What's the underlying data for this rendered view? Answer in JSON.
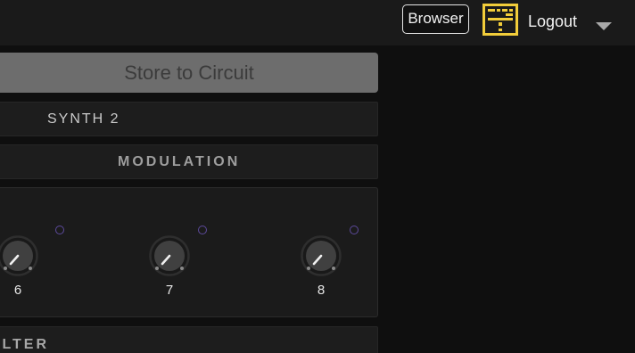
{
  "header": {
    "browser_label": "Browser",
    "logout_label": "Logout"
  },
  "patch": {
    "store_label": "Store to Circuit",
    "synth_name": "SYNTH 2"
  },
  "sections": {
    "modulation_title": "MODULATION",
    "filter_title": "ILTER"
  },
  "knobs": [
    {
      "label": "6"
    },
    {
      "label": "7"
    },
    {
      "label": "8"
    }
  ],
  "colors": {
    "accent_logo": "#f2cd3a",
    "mod_ring": "#5d4a9c",
    "store_button": "#6d6d6d"
  }
}
